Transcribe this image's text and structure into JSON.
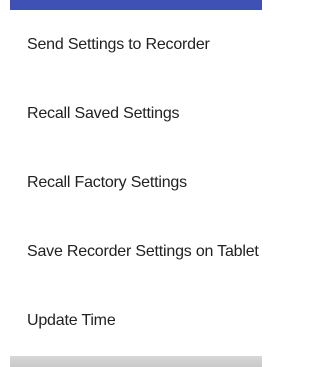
{
  "menu": {
    "items": [
      {
        "label": "Send Settings to Recorder"
      },
      {
        "label": "Recall Saved Settings"
      },
      {
        "label": "Recall Factory Settings"
      },
      {
        "label": "Save Recorder Settings on Tablet"
      },
      {
        "label": "Update Time"
      }
    ]
  },
  "colors": {
    "accent": "#3f51b5",
    "text": "#212121",
    "background": "#ffffff"
  }
}
